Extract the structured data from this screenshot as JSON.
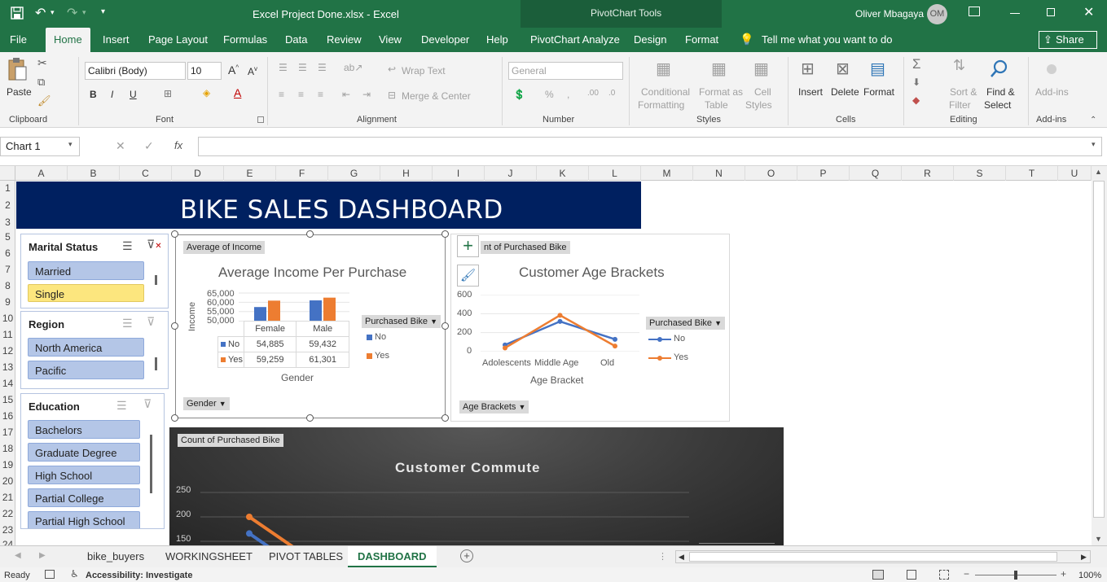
{
  "window": {
    "title": "Excel Project Done.xlsx  -  Excel",
    "tools_context": "PivotChart Tools",
    "user_name": "Oliver Mbagaya",
    "user_initials": "OM"
  },
  "tabs": [
    "File",
    "Home",
    "Insert",
    "Page Layout",
    "Formulas",
    "Data",
    "Review",
    "View",
    "Developer",
    "Help",
    "PivotChart Analyze",
    "Design",
    "Format"
  ],
  "tell_me": "Tell me what you want to do",
  "share_label": "Share",
  "ribbon": {
    "clipboard": {
      "paste": "Paste",
      "label": "Clipboard"
    },
    "font": {
      "name": "Calibri (Body)",
      "size": "10",
      "label": "Font",
      "bold": "B",
      "italic": "I",
      "underline": "U"
    },
    "alignment": {
      "wrap": "Wrap Text",
      "merge": "Merge & Center",
      "label": "Alignment"
    },
    "number": {
      "format": "General",
      "label": "Number"
    },
    "styles": {
      "cond_1": "Conditional",
      "cond_2": "Formatting",
      "fmt_1": "Format as",
      "fmt_2": "Table",
      "cell_1": "Cell",
      "cell_2": "Styles",
      "label": "Styles"
    },
    "cells": {
      "insert": "Insert",
      "delete": "Delete",
      "format": "Format",
      "label": "Cells"
    },
    "editing": {
      "sort_1": "Sort &",
      "sort_2": "Filter",
      "find_1": "Find &",
      "find_2": "Select",
      "label": "Editing"
    },
    "addins": {
      "btn": "Add-ins",
      "label": "Add-ins"
    }
  },
  "formula_bar": {
    "name_box": "Chart 1",
    "fx": "fx",
    "value": ""
  },
  "columns": [
    "A",
    "B",
    "C",
    "D",
    "E",
    "F",
    "G",
    "H",
    "I",
    "J",
    "K",
    "L",
    "M",
    "N",
    "O",
    "P",
    "Q",
    "R",
    "S",
    "T",
    "U"
  ],
  "rows": [
    "1",
    "2",
    "3",
    "5",
    "6",
    "7",
    "8",
    "9",
    "10",
    "11",
    "12",
    "13",
    "14",
    "15",
    "16",
    "17",
    "18",
    "19",
    "20",
    "21",
    "22",
    "23",
    "24"
  ],
  "dashboard": {
    "title": "BIKE SALES DASHBOARD"
  },
  "slicers": {
    "marital": {
      "header": "Marital Status",
      "items": [
        "Married",
        "Single"
      ]
    },
    "region": {
      "header": "Region",
      "items": [
        "North America",
        "Pacific"
      ]
    },
    "education": {
      "header": "Education",
      "items": [
        "Bachelors",
        "Graduate Degree",
        "High School",
        "Partial College",
        "Partial High School"
      ]
    }
  },
  "income_chart": {
    "field_value": "Average of Income",
    "title": "Average Income Per Purchase",
    "ylabel": "Income",
    "xlabel": "Gender",
    "yticks": [
      "65,000",
      "60,000",
      "55,000",
      "50,000"
    ],
    "legend_title": "Purchased Bike",
    "axis_button": "Gender",
    "legend_no": "No",
    "legend_yes": "Yes",
    "table_categories": [
      "Female",
      "Male"
    ],
    "table_no": [
      "54,885",
      "59,432"
    ],
    "table_yes": [
      "59,259",
      "61,301"
    ]
  },
  "age_chart": {
    "field_value": "nt of Purchased Bike",
    "title": "Customer Age Brackets",
    "xlabel": "Age Bracket",
    "categories": [
      "Adolescents",
      "Middle Age",
      "Old"
    ],
    "yticks": [
      "600",
      "400",
      "200",
      "0"
    ],
    "legend_title": "Purchased Bike",
    "legend_no": "No",
    "legend_yes": "Yes",
    "axis_button": "Age Brackets"
  },
  "commute_chart": {
    "field_value": "Count of Purchased Bike",
    "title": "Customer Commute",
    "yticks": [
      "250",
      "200",
      "150"
    ]
  },
  "chart_data": [
    {
      "type": "bar",
      "title": "Average Income Per Purchase",
      "xlabel": "Gender",
      "ylabel": "Income",
      "categories": [
        "Female",
        "Male"
      ],
      "ylim": [
        45000,
        65000
      ],
      "series": [
        {
          "name": "No",
          "values": [
            54885,
            59432
          ],
          "color": "#4472c4"
        },
        {
          "name": "Yes",
          "values": [
            59259,
            61301
          ],
          "color": "#ed7d31"
        }
      ]
    },
    {
      "type": "line",
      "title": "Customer Age Brackets",
      "xlabel": "Age Bracket",
      "categories": [
        "Adolescents",
        "Middle Age",
        "Old"
      ],
      "ylim": [
        0,
        600
      ],
      "series": [
        {
          "name": "No",
          "values": [
            71,
            318,
            130
          ],
          "color": "#4472c4"
        },
        {
          "name": "Yes",
          "values": [
            39,
            383,
            59
          ],
          "color": "#ed7d31"
        }
      ]
    },
    {
      "type": "line",
      "title": "Customer Commute",
      "ylim": [
        0,
        250
      ],
      "series": [
        {
          "values": [
            166
          ],
          "color": "#4472c4"
        },
        {
          "values": [
            200
          ],
          "color": "#ed7d31"
        }
      ]
    }
  ],
  "sheets": [
    "bike_buyers",
    "WORKINGSHEET",
    "PIVOT TABLES",
    "DASHBOARD"
  ],
  "active_sheet": "DASHBOARD",
  "status": {
    "ready": "Ready",
    "accessibility": "Accessibility: Investigate",
    "zoom": "100%"
  },
  "colors": {
    "excel_green": "#217346",
    "dashboard_banner": "#002060",
    "slicer_item": "#b4c6e7",
    "slicer_selected": "#fce67e",
    "series_no": "#4472c4",
    "series_yes": "#ed7d31"
  }
}
